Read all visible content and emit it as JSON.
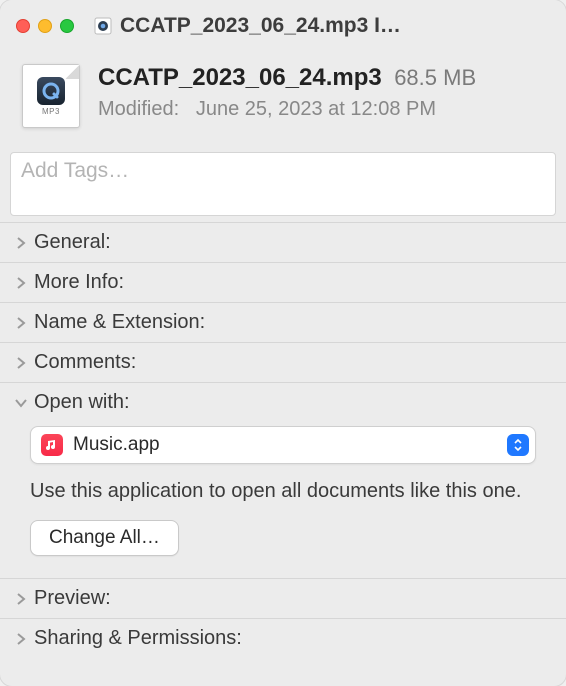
{
  "window_title": "CCATP_2023_06_24.mp3 I…",
  "file": {
    "name": "CCATP_2023_06_24.mp3",
    "size": "68.5 MB",
    "ext_label": "MP3",
    "modified_label": "Modified:",
    "modified_value": "June 25, 2023 at 12:08 PM"
  },
  "tags_placeholder": "Add Tags…",
  "sections": {
    "general": "General:",
    "more_info": "More Info:",
    "name_ext": "Name & Extension:",
    "comments": "Comments:",
    "open_with": "Open with:",
    "preview": "Preview:",
    "sharing": "Sharing & Permissions:"
  },
  "open_with": {
    "app": "Music.app",
    "hint": "Use this application to open all documents like this one.",
    "change_all": "Change All…"
  },
  "icons": {
    "music": "music-note-icon",
    "quicktime": "quicktime-icon"
  }
}
